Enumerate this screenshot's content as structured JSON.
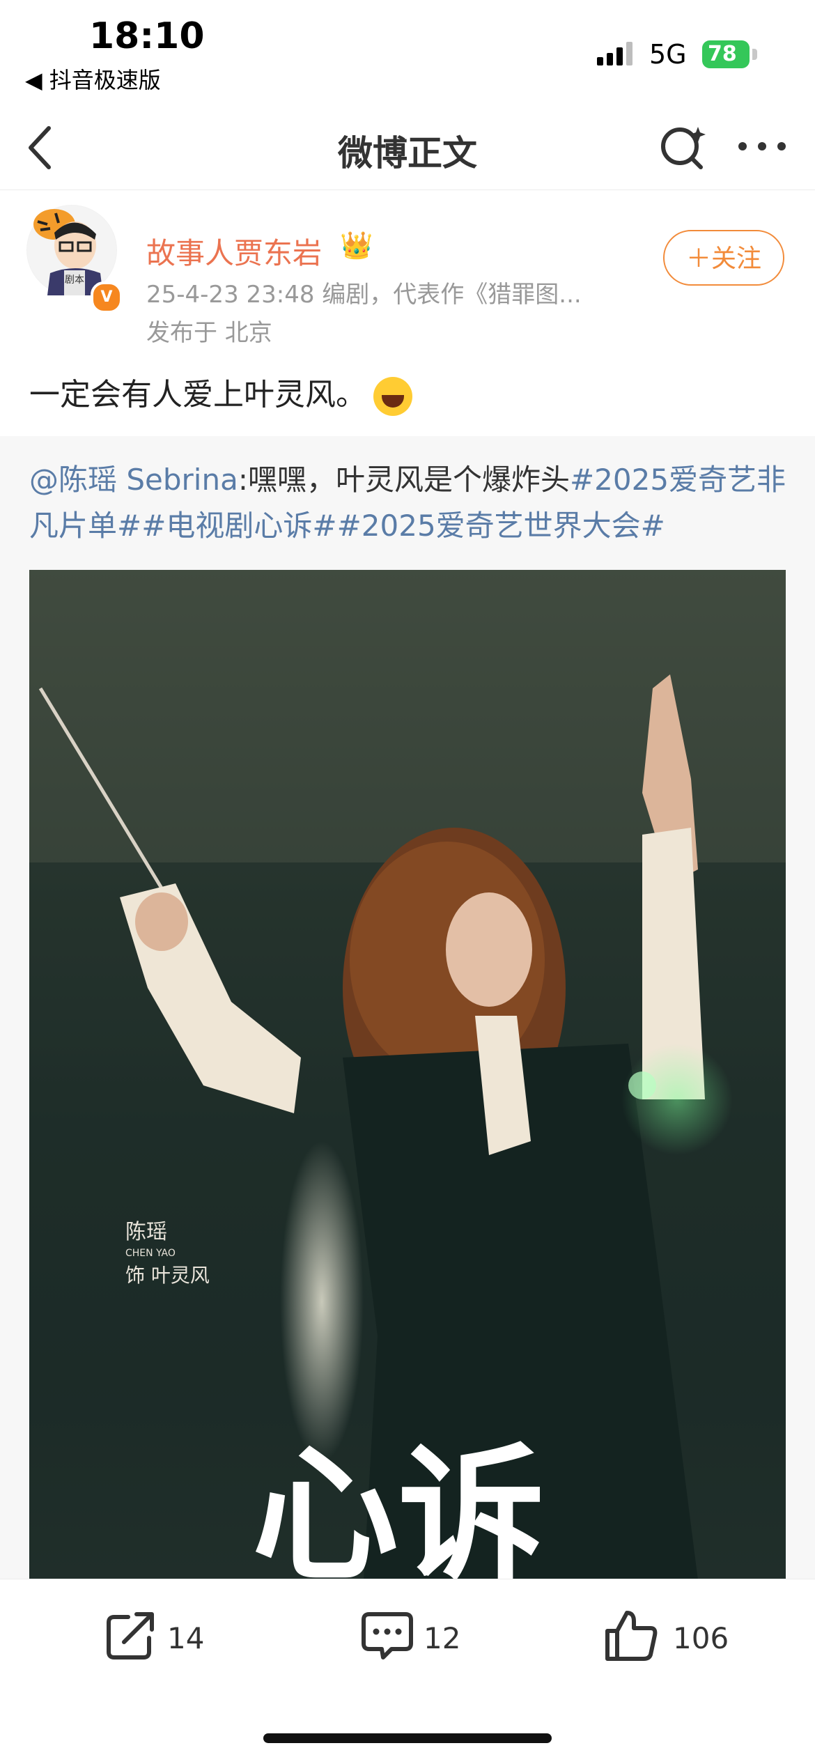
{
  "status": {
    "time": "18:10",
    "back_app": "◀ 抖音极速版",
    "network": "5G",
    "battery": "78"
  },
  "nav": {
    "title": "微博正文"
  },
  "post": {
    "author": "故事人贾东岩",
    "avatar_text": "剧本",
    "meta": "25-4-23 23:48  编剧，代表作《猎罪图...",
    "location": "发布于 北京",
    "follow_label": "＋关注",
    "text": "一定会有人爱上叶灵风。"
  },
  "repost": {
    "mention": "@陈瑶 Sebrina",
    "content": ":嘿嘿，叶灵风是个爆炸头",
    "tag1": "#2025爱奇艺非凡片单#",
    "tag2": "#电视剧心诉#",
    "tag3": "#2025爱奇艺世界大会#",
    "poster": {
      "actor_cn": "陈瑶",
      "actor_en": "CHEN YAO",
      "role": "饰 叶灵风",
      "title": "心诉"
    }
  },
  "actions": {
    "share_count": "14",
    "comment_count": "12",
    "like_count": "106"
  },
  "colors": {
    "accent": "#eb7350",
    "link": "#5a7ca7",
    "follow": "#f28b3a"
  }
}
